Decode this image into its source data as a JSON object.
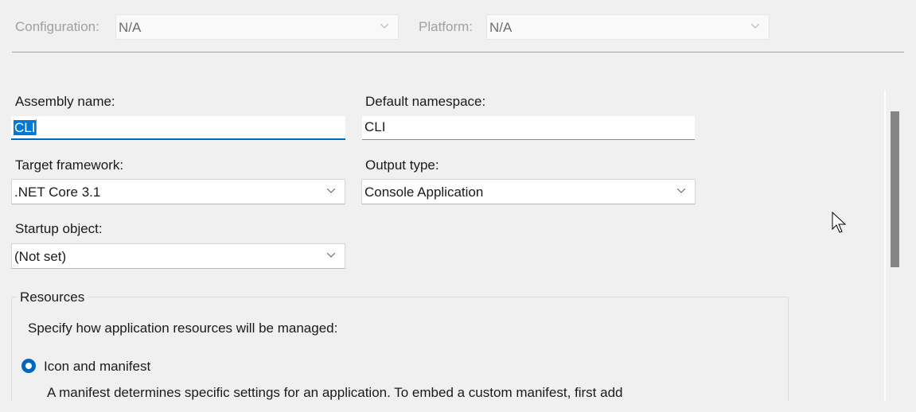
{
  "toolbar": {
    "configuration_label": "Configuration:",
    "configuration_value": "N/A",
    "platform_label": "Platform:",
    "platform_value": "N/A"
  },
  "form": {
    "assembly_name_label": "Assembly name:",
    "assembly_name_value": "CLI",
    "default_namespace_label": "Default namespace:",
    "default_namespace_value": "CLI",
    "target_framework_label": "Target framework:",
    "target_framework_value": ".NET Core 3.1",
    "output_type_label": "Output type:",
    "output_type_value": "Console Application",
    "startup_object_label": "Startup object:",
    "startup_object_value": "(Not set)"
  },
  "resources": {
    "title": "Resources",
    "description": "Specify how application resources will be managed:",
    "option_icon_manifest_label": "Icon and manifest",
    "option_icon_manifest_selected": true,
    "manifest_help": "A manifest determines specific settings for an application. To embed a custom manifest, first add"
  },
  "colors": {
    "accent": "#0067c0",
    "background": "#f0f0f0",
    "scrollbar_thumb": "#858585"
  }
}
